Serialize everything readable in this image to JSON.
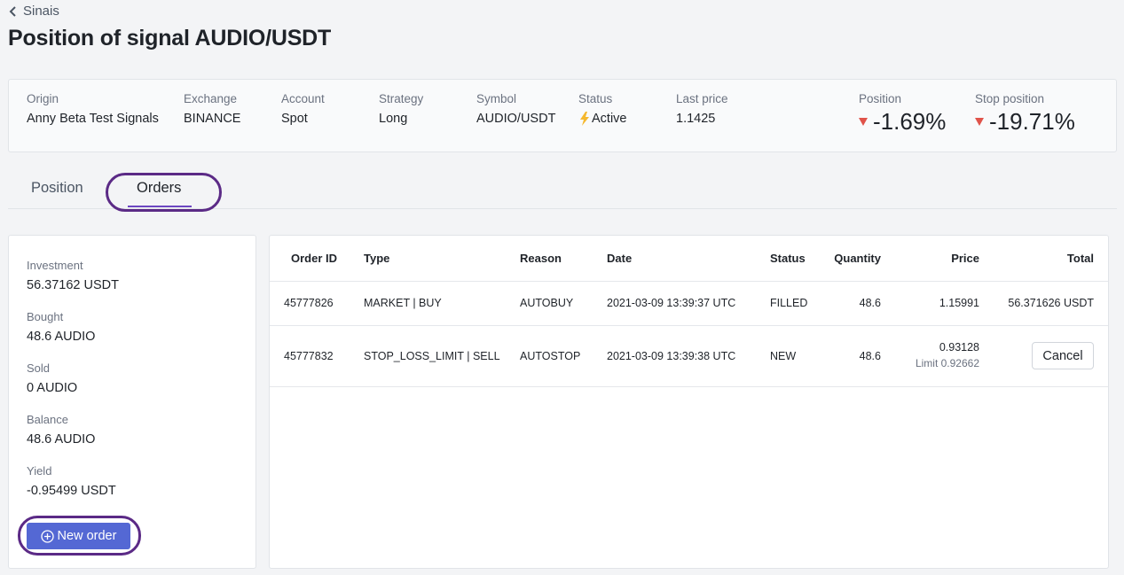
{
  "breadcrumb": {
    "back_label": "Sinais"
  },
  "page_title": "Position of signal AUDIO/USDT",
  "info": {
    "origin": {
      "label": "Origin",
      "value": "Anny Beta Test Signals"
    },
    "exchange": {
      "label": "Exchange",
      "value": "BINANCE"
    },
    "account": {
      "label": "Account",
      "value": "Spot"
    },
    "strategy": {
      "label": "Strategy",
      "value": "Long"
    },
    "symbol": {
      "label": "Symbol",
      "value": "AUDIO/USDT"
    },
    "status": {
      "label": "Status",
      "value": "Active",
      "icon": "lightning-bolt-icon"
    },
    "last_price": {
      "label": "Last price",
      "value": "1.1425"
    },
    "position": {
      "label": "Position",
      "value": "-1.69%",
      "icon": "triangle-down-icon"
    },
    "stop_position": {
      "label": "Stop position",
      "value": "-19.71%",
      "icon": "triangle-down-icon"
    }
  },
  "tabs": [
    {
      "label": "Position",
      "active": false
    },
    {
      "label": "Orders",
      "active": true
    }
  ],
  "summary": {
    "investment": {
      "label": "Investment",
      "value": "56.37162 USDT"
    },
    "bought": {
      "label": "Bought",
      "value": "48.6 AUDIO"
    },
    "sold": {
      "label": "Sold",
      "value": "0 AUDIO"
    },
    "balance": {
      "label": "Balance",
      "value": "48.6 AUDIO"
    },
    "yield": {
      "label": "Yield",
      "value": "-0.95499 USDT"
    },
    "new_order_label": "New order"
  },
  "orders": {
    "columns": [
      "Order ID",
      "Type",
      "Reason",
      "Date",
      "Status",
      "Quantity",
      "Price",
      "Total"
    ],
    "rows": [
      {
        "order_id": "45777826",
        "type": "MARKET | BUY",
        "reason": "AUTOBUY",
        "date": "2021-03-09 13:39:37 UTC",
        "status": "FILLED",
        "quantity": "48.6",
        "price": "1.15991",
        "total": "56.371626 USDT"
      },
      {
        "order_id": "45777832",
        "type": "STOP_LOSS_LIMIT | SELL",
        "reason": "AUTOSTOP",
        "date": "2021-03-09 13:39:38 UTC",
        "status": "NEW",
        "quantity": "48.6",
        "price": "0.93128",
        "limit": "Limit 0.92662",
        "action_label": "Cancel"
      }
    ]
  },
  "colors": {
    "accent": "#5468d4",
    "highlight_ring": "#5b2a86",
    "negative": "#e0534a",
    "bolt": "#f5b82e"
  }
}
